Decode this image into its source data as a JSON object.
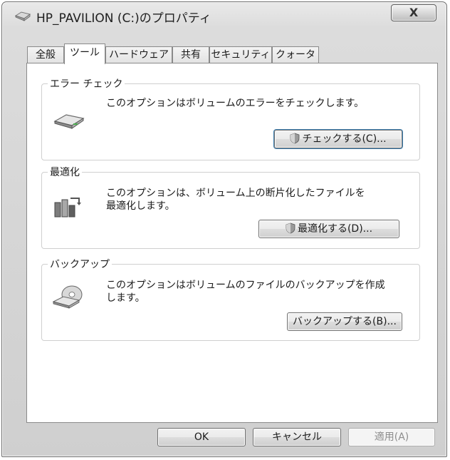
{
  "window": {
    "title": "HP_PAVILION (C:)のプロパティ",
    "close_glyph": "X"
  },
  "tabs": [
    {
      "label": "全般"
    },
    {
      "label": "ツール",
      "active": true
    },
    {
      "label": "ハードウェア"
    },
    {
      "label": "共有"
    },
    {
      "label": "セキュリティ"
    },
    {
      "label": "クォータ"
    }
  ],
  "groups": {
    "error_check": {
      "title": "エラー チェック",
      "description": "このオプションはボリュームのエラーをチェックします。",
      "icon": "drive-icon",
      "button": "チェックする(C)..."
    },
    "defrag": {
      "title": "最適化",
      "description": "このオプションは、ボリューム上の断片化したファイルを\n最適化します。",
      "icon": "defrag-icon",
      "button": "最適化する(D)..."
    },
    "backup": {
      "title": "バックアップ",
      "description": "このオプションはボリュームのファイルのバックアップを作成\nします。",
      "icon": "backup-icon",
      "button": "バックアップする(B)..."
    }
  },
  "footer": {
    "ok": "OK",
    "cancel": "キャンセル",
    "apply": "適用(A)"
  }
}
